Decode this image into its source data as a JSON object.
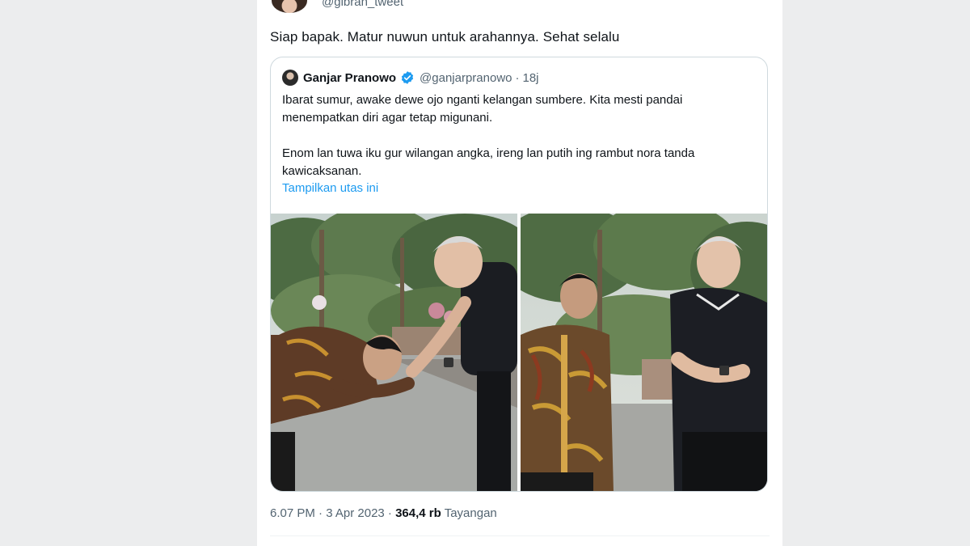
{
  "author": {
    "handle": "@gibran_tweet"
  },
  "tweet": {
    "text": "Siap bapak. Matur nuwun untuk arahannya. Sehat selalu"
  },
  "quoted": {
    "name": "Ganjar Pranowo",
    "handle": "@ganjarpranowo",
    "separator": "·",
    "time": "18j",
    "paragraph1": "Ibarat sumur, awake dewe ojo nganti kelangan sumbere. Kita mesti pandai menempatkan diri agar tetap migunani.",
    "paragraph2": "Enom lan tuwa iku gur wilangan angka, ireng lan putih ing rambut nora tanda kawicaksanan.",
    "show_thread": "Tampilkan utas ini"
  },
  "meta": {
    "time": "6.07 PM · 3 Apr 2023 ·",
    "views_count": "364,4 rb",
    "views_label": "Tayangan"
  },
  "colors": {
    "accent": "#1d9bf0",
    "secondary_text": "#536471",
    "border": "#cfd9de"
  }
}
